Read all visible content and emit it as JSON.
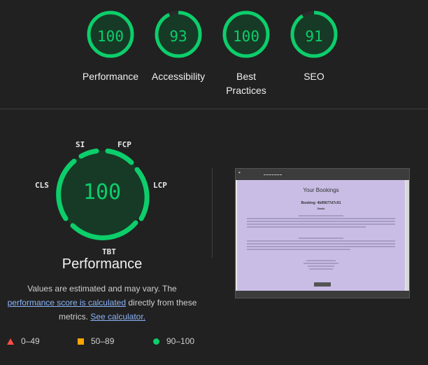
{
  "scores": [
    {
      "label": "Performance",
      "value": "100",
      "fraction": 1.0
    },
    {
      "label": "Accessibility",
      "value": "93",
      "fraction": 0.93
    },
    {
      "label": "Best Practices",
      "value": "100",
      "fraction": 1.0
    },
    {
      "label": "SEO",
      "value": "91",
      "fraction": 0.91
    }
  ],
  "performance": {
    "score": "100",
    "title": "Performance",
    "metrics": {
      "si": "SI",
      "fcp": "FCP",
      "lcp": "LCP",
      "tbt": "TBT",
      "cls": "CLS"
    }
  },
  "explanation": {
    "text_before": "Values are estimated and may vary. The",
    "link_score": "performance score is calculated",
    "text_middle": "directly from these metrics.",
    "link_calculator": "See calculator."
  },
  "legend": {
    "fail": "0–49",
    "average": "50–89",
    "pass": "90–100"
  },
  "thumbnail": {
    "page_title": "Your Bookings",
    "booking": "Booking: 4b99677d7c91",
    "status": "Dasis"
  },
  "colors": {
    "pass": "#0cce6b",
    "average": "#ffa400",
    "fail": "#ff4e42",
    "background": "#212121"
  }
}
